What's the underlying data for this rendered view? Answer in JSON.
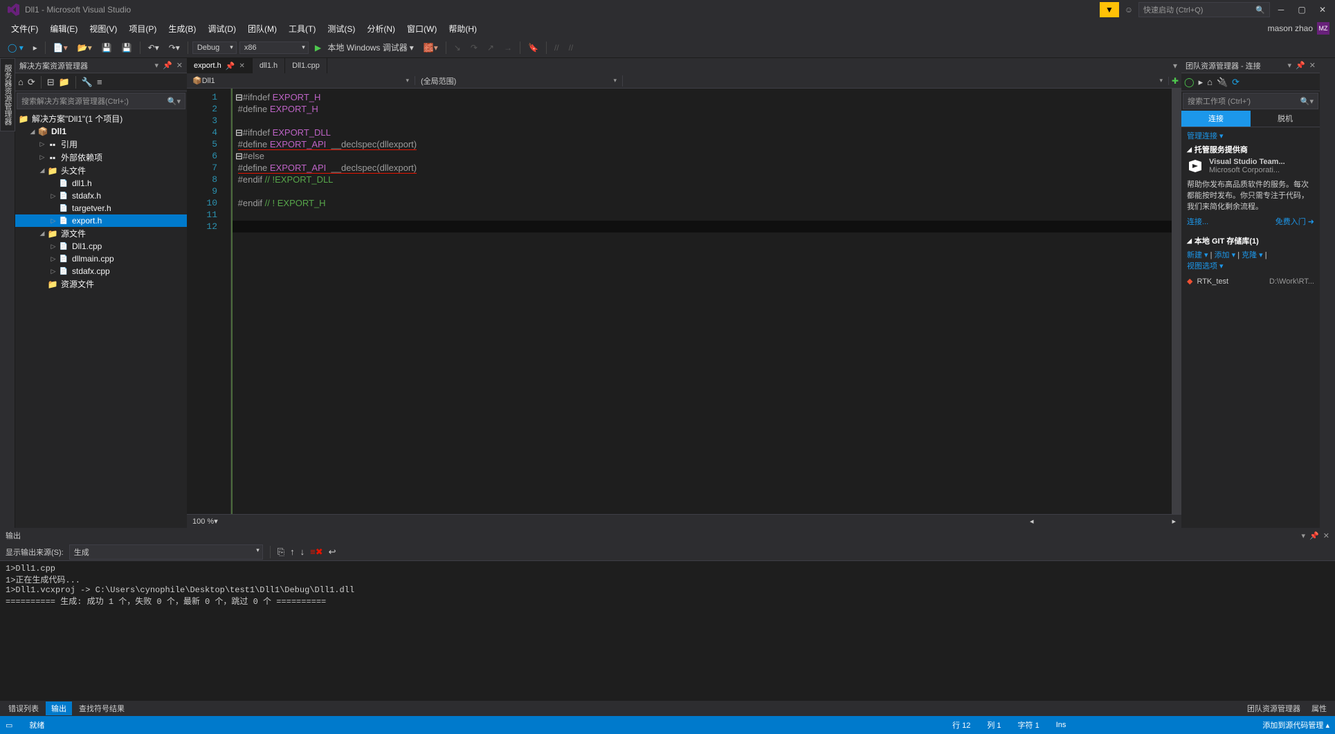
{
  "title": "Dll1 - Microsoft Visual Studio",
  "quicklaunch_placeholder": "快速启动 (Ctrl+Q)",
  "user_name": "mason zhao",
  "user_initials": "MZ",
  "menu": {
    "file": "文件(F)",
    "edit": "编辑(E)",
    "view": "视图(V)",
    "project": "项目(P)",
    "build": "生成(B)",
    "debug": "调试(D)",
    "team": "团队(M)",
    "tools": "工具(T)",
    "test": "测试(S)",
    "analyze": "分析(N)",
    "window": "窗口(W)",
    "help": "帮助(H)"
  },
  "toolbar": {
    "config": "Debug",
    "platform": "x86",
    "debugger": "本地 Windows 调试器"
  },
  "side_tab": "服务器资源管理器",
  "solexp": {
    "title": "解决方案资源管理器",
    "search_placeholder": "搜索解决方案资源管理器(Ctrl+;)",
    "tree": {
      "sol": "解决方案\"Dll1\"(1 个项目)",
      "proj": "Dll1",
      "refs": "引用",
      "ext": "外部依赖项",
      "headers": "头文件",
      "h1": "dll1.h",
      "h2": "stdafx.h",
      "h3": "targetver.h",
      "h4": "export.h",
      "sources": "源文件",
      "s1": "Dll1.cpp",
      "s2": "dllmain.cpp",
      "s3": "stdafx.cpp",
      "res": "资源文件"
    }
  },
  "tabs": {
    "t1": "export.h",
    "t2": "dll1.h",
    "t3": "Dll1.cpp"
  },
  "ctx": {
    "left": "Dll1",
    "right": "(全局范围)"
  },
  "code": {
    "l1a": "#ifndef ",
    "l1b": "EXPORT_H",
    "l2a": "#define ",
    "l2b": "EXPORT_H",
    "l4a": "#ifndef ",
    "l4b": "EXPORT_DLL",
    "l5a": "#define ",
    "l5b": "EXPORT_API",
    "l5c": "  __declspec(dllexport)",
    "l6": "#else",
    "l7a": "#define ",
    "l7b": "EXPORT_API",
    "l7c": "  __declspec(dllexport)",
    "l8a": "#endif ",
    "l8b": "// !EXPORT_DLL",
    "l10a": "#endif ",
    "l10b": "// ! EXPORT_H"
  },
  "zoom": "100 %",
  "team": {
    "title": "团队资源管理器 - 连接",
    "search": "搜索工作项 (Ctrl+')",
    "tab_connect": "连接",
    "tab_offline": "脱机",
    "manage": "管理连接 ▾",
    "hosted": "托管服务提供商",
    "vsteam": "Visual Studio Team...",
    "mscorp": "Microsoft Corporati...",
    "desc": "帮助你发布高品质软件的服务。每次都能按时发布。你只需专注于代码，我们来简化剩余流程。",
    "connect": "连接...",
    "free": "免费入门",
    "localgit": "本地 GIT 存储库(1)",
    "new": "新建 ▾",
    "add": "添加 ▾",
    "clone": "克隆 ▾",
    "viewopt": "视图选项 ▾",
    "repo": "RTK_test",
    "repopath": "D:\\Work\\RT..."
  },
  "output": {
    "title": "输出",
    "source_label": "显示输出来源(S):",
    "source": "生成",
    "text": "1>Dll1.cpp\n1>正在生成代码...\n1>Dll1.vcxproj -> C:\\Users\\cynophile\\Desktop\\test1\\Dll1\\Debug\\Dll1.dll\n========== 生成: 成功 1 个，失败 0 个，最新 0 个，跳过 0 个 =========="
  },
  "bottom_tabs": {
    "err": "错误列表",
    "out": "输出",
    "find": "查找符号结果",
    "team": "团队资源管理器",
    "prop": "属性"
  },
  "status": {
    "ready": "就绪",
    "line": "行 12",
    "col": "列 1",
    "char": "字符 1",
    "ins": "Ins",
    "scm": "添加到源代码管理 ▴"
  }
}
